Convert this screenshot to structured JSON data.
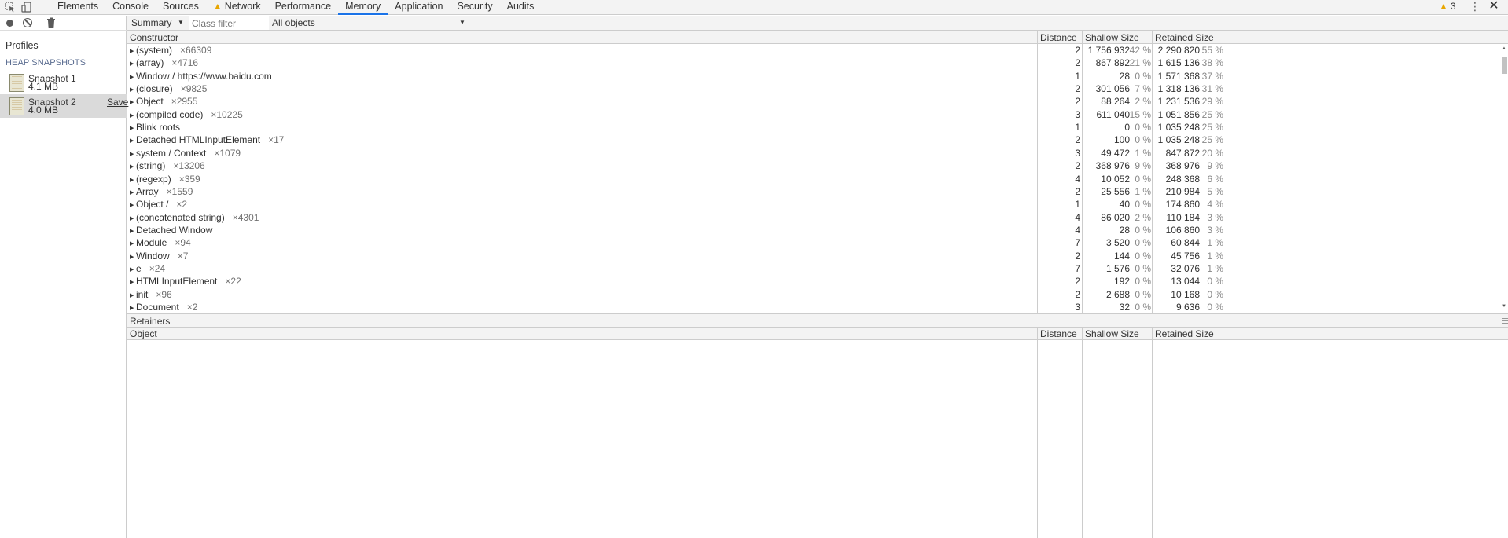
{
  "toolbar": {
    "tabs": [
      {
        "label": "Elements"
      },
      {
        "label": "Console"
      },
      {
        "label": "Sources"
      },
      {
        "label": "Network",
        "warning": true
      },
      {
        "label": "Performance"
      },
      {
        "label": "Memory",
        "active": true
      },
      {
        "label": "Application"
      },
      {
        "label": "Security"
      },
      {
        "label": "Audits"
      }
    ],
    "warning_count": "3",
    "icons": [
      "inspect-icon",
      "device-toolbar-icon",
      "warning-icon",
      "more-menu-icon",
      "close-icon"
    ]
  },
  "sidebar": {
    "title": "Profiles",
    "section": "HEAP SNAPSHOTS",
    "snapshots": [
      {
        "name": "Snapshot 1",
        "size": "4.1 MB"
      },
      {
        "name": "Snapshot 2",
        "size": "4.0 MB",
        "selected": true,
        "save_label": "Save"
      }
    ],
    "icons": [
      "record-icon",
      "clear-icon",
      "trash-icon",
      "snapshot-icon"
    ]
  },
  "filter": {
    "view": "Summary",
    "class_filter_placeholder": "Class filter",
    "objects": "All objects"
  },
  "table": {
    "columns": {
      "constructor": "Constructor",
      "distance": "Distance",
      "shallow": "Shallow Size",
      "retained": "Retained Size"
    },
    "rows": [
      {
        "name": "(system)",
        "count": "×66309",
        "distance": "2",
        "shallow": "1 756 932",
        "shallow_pct": "42 %",
        "retained": "2 290 820",
        "retained_pct": "55 %"
      },
      {
        "name": "(array)",
        "count": "×4716",
        "distance": "2",
        "shallow": "867 892",
        "shallow_pct": "21 %",
        "retained": "1 615 136",
        "retained_pct": "38 %"
      },
      {
        "name": "Window / https://www.baidu.com",
        "count": "",
        "distance": "1",
        "shallow": "28",
        "shallow_pct": "0 %",
        "retained": "1 571 368",
        "retained_pct": "37 %"
      },
      {
        "name": "(closure)",
        "count": "×9825",
        "distance": "2",
        "shallow": "301 056",
        "shallow_pct": "7 %",
        "retained": "1 318 136",
        "retained_pct": "31 %"
      },
      {
        "name": "Object",
        "count": "×2955",
        "distance": "2",
        "shallow": "88 264",
        "shallow_pct": "2 %",
        "retained": "1 231 536",
        "retained_pct": "29 %"
      },
      {
        "name": "(compiled code)",
        "count": "×10225",
        "distance": "3",
        "shallow": "611 040",
        "shallow_pct": "15 %",
        "retained": "1 051 856",
        "retained_pct": "25 %"
      },
      {
        "name": "Blink roots",
        "count": "",
        "distance": "1",
        "shallow": "0",
        "shallow_pct": "0 %",
        "retained": "1 035 248",
        "retained_pct": "25 %"
      },
      {
        "name": "Detached HTMLInputElement",
        "count": "×17",
        "distance": "2",
        "shallow": "100",
        "shallow_pct": "0 %",
        "retained": "1 035 248",
        "retained_pct": "25 %"
      },
      {
        "name": "system / Context",
        "count": "×1079",
        "distance": "3",
        "shallow": "49 472",
        "shallow_pct": "1 %",
        "retained": "847 872",
        "retained_pct": "20 %"
      },
      {
        "name": "(string)",
        "count": "×13206",
        "distance": "2",
        "shallow": "368 976",
        "shallow_pct": "9 %",
        "retained": "368 976",
        "retained_pct": "9 %"
      },
      {
        "name": "(regexp)",
        "count": "×359",
        "distance": "4",
        "shallow": "10 052",
        "shallow_pct": "0 %",
        "retained": "248 368",
        "retained_pct": "6 %"
      },
      {
        "name": "Array",
        "count": "×1559",
        "distance": "2",
        "shallow": "25 556",
        "shallow_pct": "1 %",
        "retained": "210 984",
        "retained_pct": "5 %"
      },
      {
        "name": "Object /",
        "count": "×2",
        "distance": "1",
        "shallow": "40",
        "shallow_pct": "0 %",
        "retained": "174 860",
        "retained_pct": "4 %"
      },
      {
        "name": "(concatenated string)",
        "count": "×4301",
        "distance": "4",
        "shallow": "86 020",
        "shallow_pct": "2 %",
        "retained": "110 184",
        "retained_pct": "3 %"
      },
      {
        "name": "Detached Window",
        "count": "",
        "distance": "4",
        "shallow": "28",
        "shallow_pct": "0 %",
        "retained": "106 860",
        "retained_pct": "3 %"
      },
      {
        "name": "Module",
        "count": "×94",
        "distance": "7",
        "shallow": "3 520",
        "shallow_pct": "0 %",
        "retained": "60 844",
        "retained_pct": "1 %"
      },
      {
        "name": "Window",
        "count": "×7",
        "distance": "2",
        "shallow": "144",
        "shallow_pct": "0 %",
        "retained": "45 756",
        "retained_pct": "1 %"
      },
      {
        "name": "e",
        "count": "×24",
        "distance": "7",
        "shallow": "1 576",
        "shallow_pct": "0 %",
        "retained": "32 076",
        "retained_pct": "1 %"
      },
      {
        "name": "HTMLInputElement",
        "count": "×22",
        "distance": "2",
        "shallow": "192",
        "shallow_pct": "0 %",
        "retained": "13 044",
        "retained_pct": "0 %"
      },
      {
        "name": "init",
        "count": "×96",
        "distance": "2",
        "shallow": "2 688",
        "shallow_pct": "0 %",
        "retained": "10 168",
        "retained_pct": "0 %"
      },
      {
        "name": "Document",
        "count": "×2",
        "distance": "3",
        "shallow": "32",
        "shallow_pct": "0 %",
        "retained": "9 636",
        "retained_pct": "0 %"
      }
    ]
  },
  "retainers": {
    "title": "Retainers",
    "columns": {
      "object": "Object",
      "distance": "Distance",
      "shallow": "Shallow Size",
      "retained": "Retained Size"
    }
  }
}
